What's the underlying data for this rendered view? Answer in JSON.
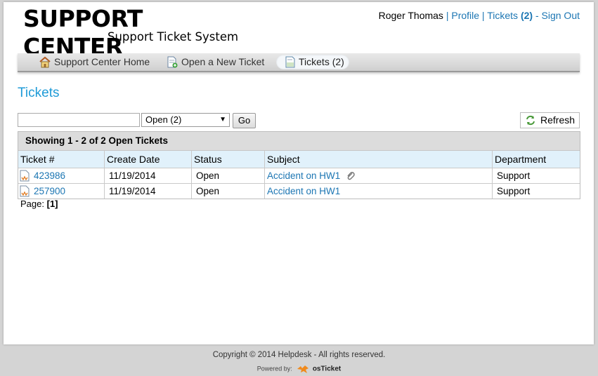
{
  "header": {
    "logo_title": "SUPPORT CENTER",
    "logo_subtitle": "Support Ticket System"
  },
  "userbar": {
    "user_name": "Roger Thomas",
    "separator1": " | ",
    "profile_link": "Profile",
    "separator2": " | ",
    "tickets_link": "Tickets",
    "tickets_count": "(2)",
    "separator3": " - ",
    "signout_link": "Sign Out"
  },
  "nav": {
    "items": [
      {
        "label": "Support Center Home",
        "icon": "home-icon"
      },
      {
        "label": "Open a New Ticket",
        "icon": "new-ticket-icon"
      },
      {
        "label": "Tickets (2)",
        "icon": "tickets-icon",
        "active": true
      }
    ]
  },
  "page": {
    "title": "Tickets"
  },
  "filters": {
    "search_value": "",
    "status_selected": "Open (2)",
    "go_label": "Go",
    "refresh_label": "Refresh"
  },
  "table": {
    "caption": "Showing  1 - 2 of 2 Open Tickets",
    "columns": [
      "Ticket #",
      "Create Date",
      "Status",
      "Subject",
      "Department"
    ],
    "rows": [
      {
        "ticket": "423986",
        "date": "11/19/2014",
        "status": "Open",
        "subject": "Accident on HW1",
        "department": "Support",
        "attachment": true
      },
      {
        "ticket": "257900",
        "date": "11/19/2014",
        "status": "Open",
        "subject": "Accident on HW1",
        "department": "Support",
        "attachment": false
      }
    ]
  },
  "pager": {
    "label": "Page:",
    "current": "[1]"
  },
  "footer": {
    "copyright": "Copyright © 2014 Helpdesk - All rights reserved.",
    "powered_by": "Powered by:",
    "brand": "osTicket"
  },
  "colors": {
    "link": "#1c76b3",
    "title": "#1f9bd7",
    "table_header": "#e1f1fb"
  }
}
